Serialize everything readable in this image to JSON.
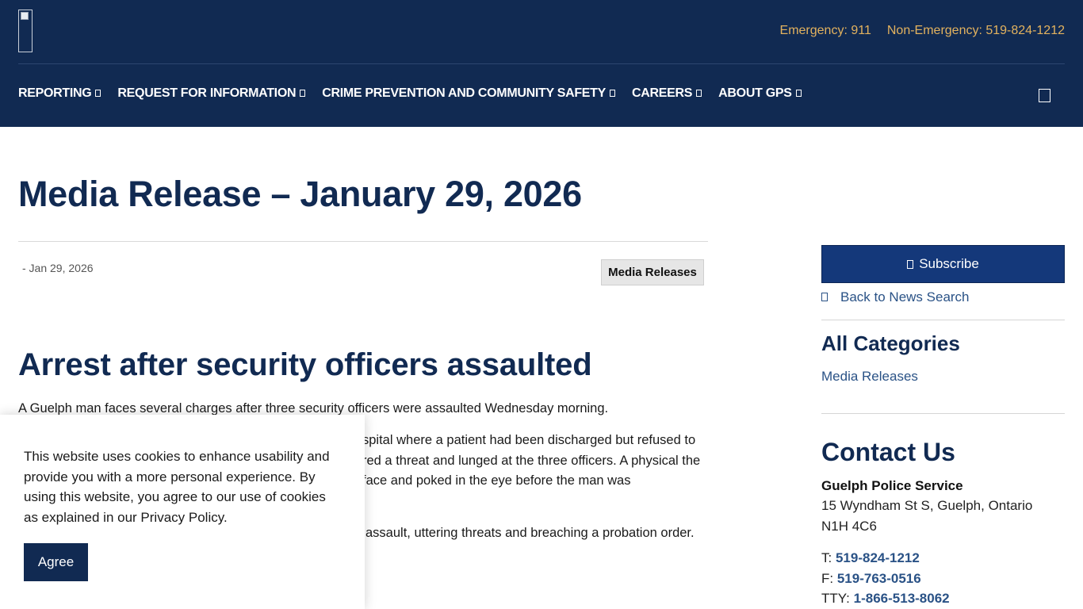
{
  "header": {
    "emergency": "Emergency: 911",
    "non_emergency": "Non-Emergency: 519-824-1212",
    "nav": [
      {
        "label": "REPORTING"
      },
      {
        "label": "REQUEST FOR INFORMATION"
      },
      {
        "label": "CRIME PREVENTION AND COMMUNITY SAFETY"
      },
      {
        "label": "CAREERS"
      },
      {
        "label": "ABOUT GPS"
      }
    ],
    "icons": {
      "logo": "broken-image-icon",
      "caret": "chevron-down-icon",
      "search": "search-icon"
    }
  },
  "main": {
    "title": "Media Release – January 29, 2026",
    "date": "- Jan 29, 2026",
    "category": "Media Releases",
    "article_heading": "Arrest after security officers assaulted",
    "paragraphs": [
      "A Guelph man faces several charges after three security officers were assaulted Wednesday morning.",
      "spital where a patient had been discharged but refused to red a threat and lunged at the three officers. A physical the face and poked in the eye before the man was",
      "assault, uttering threats and breaching a probation order."
    ]
  },
  "sidebar": {
    "subscribe": "Subscribe",
    "back": "Back to News Search",
    "categories_heading": "All Categories",
    "categories": [
      "Media Releases"
    ],
    "contact_heading": "Contact Us",
    "org": "Guelph Police Service",
    "address_line1": "15 Wyndham St S, Guelph, Ontario",
    "address_line2": "N1H 4C6",
    "phones": [
      {
        "prefix": "T:",
        "number": "519-824-1212"
      },
      {
        "prefix": "F:",
        "number": "519-763-0516"
      },
      {
        "prefix": "TTY:",
        "number": "1-866-513-8062"
      }
    ]
  },
  "cookie": {
    "text": "This website uses cookies to enhance usability and provide you with a more personal experience. By using this website, you agree to our use of cookies as explained in our Privacy Policy.",
    "button": "Agree"
  },
  "colors": {
    "navy": "#112a52",
    "gold": "#e3b25e",
    "link": "#2a5286",
    "button": "#14387a"
  }
}
